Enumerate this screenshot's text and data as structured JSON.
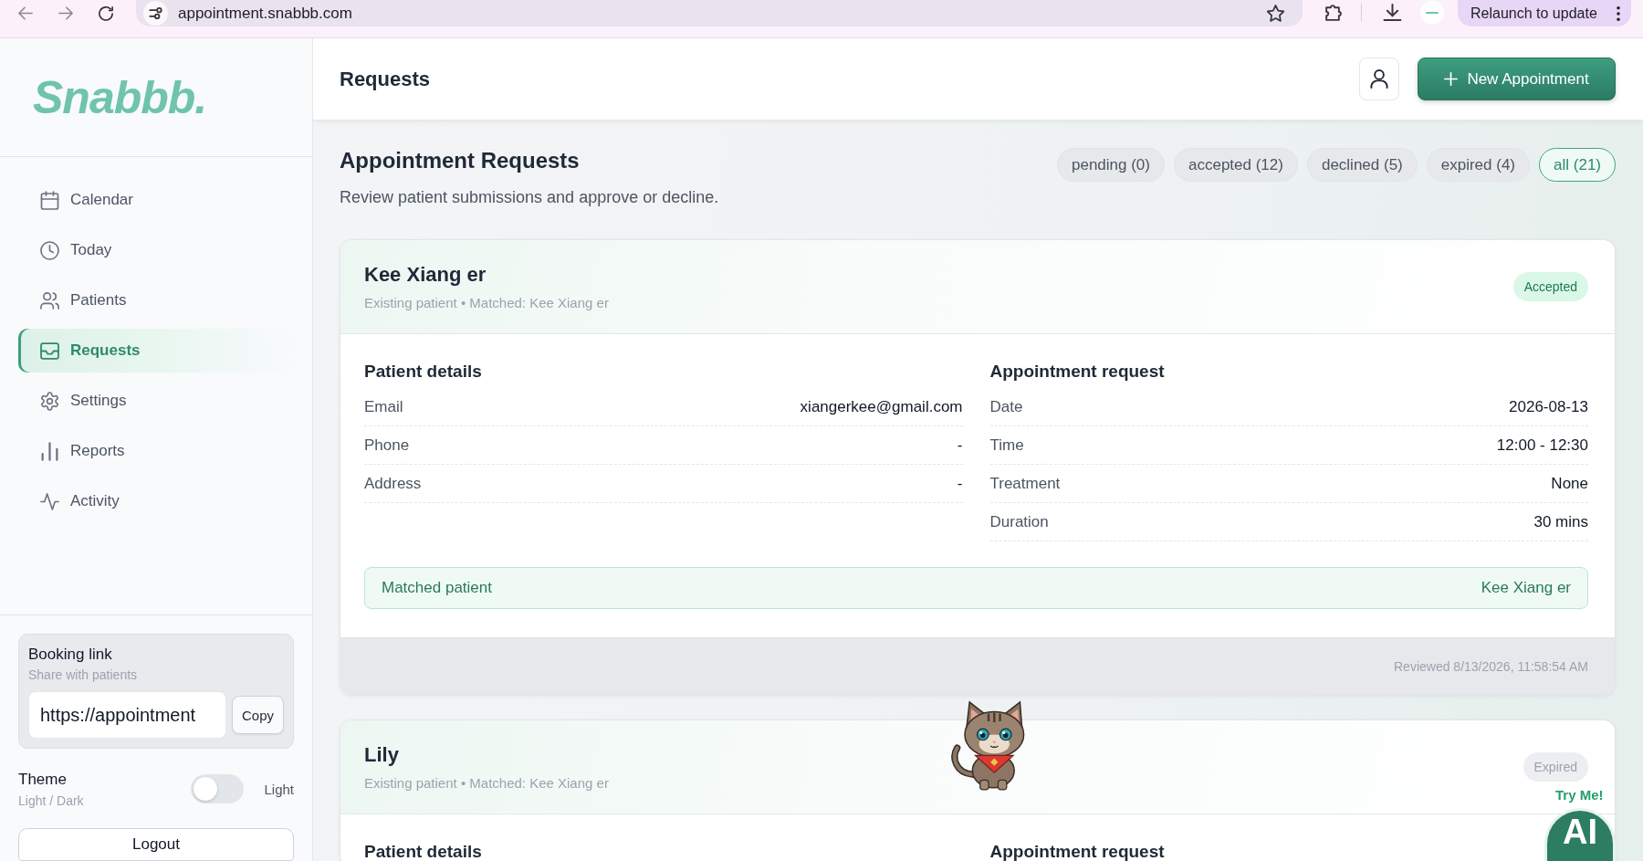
{
  "browser": {
    "url": "appointment.snabbb.com",
    "relaunch": "Relaunch to update"
  },
  "sidebar": {
    "logo": "Snabbb.",
    "nav": [
      {
        "label": "Calendar",
        "selected": false
      },
      {
        "label": "Today",
        "selected": false
      },
      {
        "label": "Patients",
        "selected": false
      },
      {
        "label": "Requests",
        "selected": true
      },
      {
        "label": "Settings",
        "selected": false
      },
      {
        "label": "Reports",
        "selected": false
      },
      {
        "label": "Activity",
        "selected": false
      }
    ],
    "booking_link": {
      "title": "Booking link",
      "subtitle": "Share with patients",
      "value": "https://appointment",
      "copy": "Copy"
    },
    "theme": {
      "title": "Theme",
      "subtitle": "Light / Dark",
      "on": false,
      "state": "Light"
    },
    "logout": "Logout"
  },
  "header": {
    "title": "Requests",
    "new_appointment": "New Appointment"
  },
  "requests_page": {
    "title": "Appointment Requests",
    "description": "Review patient submissions and approve or decline.",
    "filters": [
      {
        "label": "pending (0)",
        "selected": false
      },
      {
        "label": "accepted (12)",
        "selected": false
      },
      {
        "label": "declined (5)",
        "selected": false
      },
      {
        "label": "expired (4)",
        "selected": false
      },
      {
        "label": "all (21)",
        "selected": true
      }
    ]
  },
  "requests": [
    {
      "name": "Kee Xiang er",
      "subtitle": "Existing patient • Matched: Kee Xiang er",
      "status": {
        "label": "Accepted",
        "kind": "accepted"
      },
      "patient_details": {
        "title": "Patient details",
        "rows": [
          {
            "label": "Email",
            "value": "xiangerkee@gmail.com"
          },
          {
            "label": "Phone",
            "value": "-"
          },
          {
            "label": "Address",
            "value": "-"
          }
        ]
      },
      "appointment": {
        "title": "Appointment request",
        "rows": [
          {
            "label": "Date",
            "value": "2026-08-13"
          },
          {
            "label": "Time",
            "value": "12:00 - 12:30"
          },
          {
            "label": "Treatment",
            "value": "None"
          },
          {
            "label": "Duration",
            "value": "30 mins"
          }
        ]
      },
      "matched": {
        "label": "Matched patient",
        "value": "Kee Xiang er"
      },
      "footer": "Reviewed 8/13/2026, 11:58:54 AM"
    },
    {
      "name": "Lily",
      "subtitle": "Existing patient • Matched: Kee Xiang er",
      "status": {
        "label": "Expired",
        "kind": "expired"
      },
      "patient_details": {
        "title": "Patient details"
      },
      "appointment": {
        "title": "Appointment request"
      }
    }
  ],
  "assistant": {
    "badge": "Try Me!",
    "label": "AI"
  }
}
